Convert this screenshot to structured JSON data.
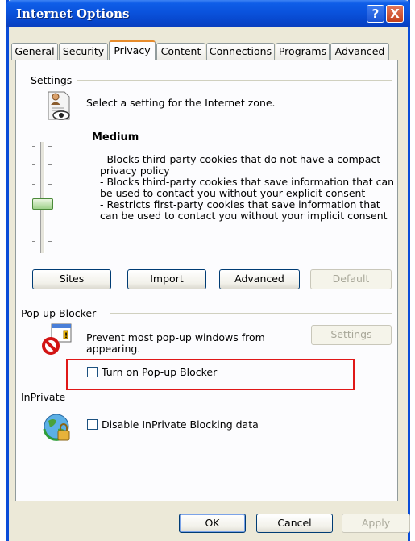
{
  "window": {
    "title": "Internet Options"
  },
  "titlebar": {
    "help_glyph": "?",
    "close_glyph": "X"
  },
  "tabs": [
    {
      "label": "General"
    },
    {
      "label": "Security"
    },
    {
      "label": "Privacy",
      "active": true
    },
    {
      "label": "Content"
    },
    {
      "label": "Connections"
    },
    {
      "label": "Programs"
    },
    {
      "label": "Advanced"
    }
  ],
  "settings": {
    "group_label": "Settings",
    "description": "Select a setting for the Internet zone.",
    "level_title": "Medium",
    "level_lines": [
      "- Blocks third-party cookies that do not have a compact",
      "privacy policy",
      "- Blocks third-party cookies that save information that can",
      "be used to contact you without your explicit consent",
      "- Restricts first-party cookies that save information that",
      "can be used to contact you without your implicit consent"
    ],
    "buttons": {
      "sites": "Sites",
      "import": "Import",
      "advanced": "Advanced",
      "default": "Default"
    },
    "slider_level": "Medium"
  },
  "popup": {
    "group_label": "Pop-up Blocker",
    "description_line1": "Prevent most pop-up windows from",
    "description_line2": "appearing.",
    "settings_button": "Settings",
    "checkbox_label": "Turn on Pop-up Blocker",
    "checked": false
  },
  "inprivate": {
    "group_label": "InPrivate",
    "checkbox_label": "Disable InPrivate Blocking data",
    "checked": false
  },
  "footer": {
    "ok": "OK",
    "cancel": "Cancel",
    "apply": "Apply"
  },
  "icons": [
    "privacy-settings-icon",
    "popup-blocker-icon",
    "inprivate-icon",
    "help-icon",
    "close-icon"
  ]
}
